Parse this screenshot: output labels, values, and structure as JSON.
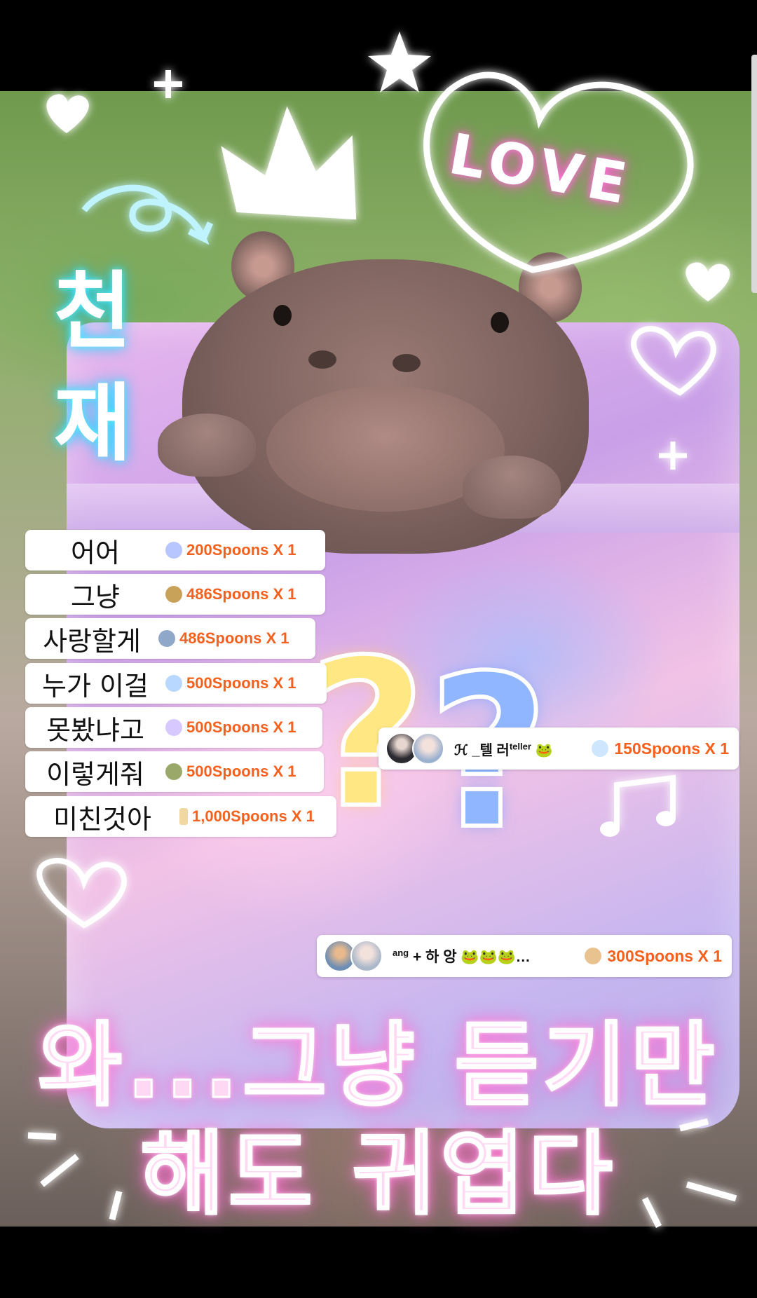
{
  "overlay_art": {
    "vertical_text": "천재",
    "love_text": "LOVE",
    "caption_line1": "와...그냥 듣기만",
    "caption_line2": "해도 귀엽다"
  },
  "gift_list": [
    {
      "lyric": "어어",
      "gift": "200Spoons X 1",
      "icon_color": "#b7c6ff"
    },
    {
      "lyric": "그냥",
      "gift": "486Spoons X 1",
      "icon_color": "#c9a25a"
    },
    {
      "lyric": "사랑할게",
      "gift": "486Spoons X 1",
      "icon_color": "#8fa7c9"
    },
    {
      "lyric": "누가 이걸",
      "gift": "500Spoons X 1",
      "icon_color": "#b9d8ff"
    },
    {
      "lyric": "못봤냐고",
      "gift": "500Spoons X 1",
      "icon_color": "#d7c8ff"
    },
    {
      "lyric": "이렇게줘",
      "gift": "500Spoons X 1",
      "icon_color": "#9aa86a"
    },
    {
      "lyric": "미친것아",
      "gift": "1,000Spoons X 1",
      "icon_color": "#f1d8a3"
    }
  ],
  "donations": [
    {
      "name": "ℋ _텔 러",
      "name_sup": "teller",
      "emoji": "🐸",
      "amount": "150Spoons X 1",
      "icon_color": "#cfe6ff"
    },
    {
      "name_sup": "ang",
      "name": " + 하 앙 🐸🐸🐸…",
      "amount": "300Spoons X 1",
      "icon_color": "#e9c38f"
    }
  ]
}
